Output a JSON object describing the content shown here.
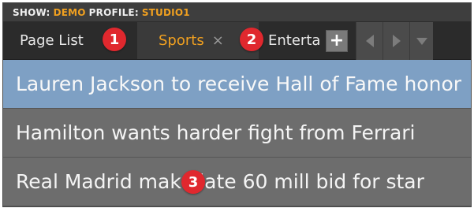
{
  "header": {
    "show_label": "SHOW:",
    "show_value": "DEMO",
    "profile_label": "PROFILE:",
    "profile_value": "STUDIO1"
  },
  "tabs": {
    "page_list": "Page List",
    "sports": "Sports",
    "sports_close": "×",
    "entertainment": "Enterta",
    "add": "+"
  },
  "badges": [
    "1",
    "2",
    "3"
  ],
  "rows": [
    {
      "title": "Lauren Jackson to receive Hall of Fame honor"
    },
    {
      "title": "Hamilton wants harder fight from Ferrari"
    },
    {
      "title": "Real Madrid make late 60 mill bid for star"
    }
  ],
  "colors": {
    "accent": "#f0a020",
    "selected_row": "#7ea0c4",
    "badge": "#e0282e"
  },
  "icons": [
    "close-icon",
    "plus-icon",
    "arrow-left-icon",
    "arrow-right-icon",
    "chevron-down-icon"
  ]
}
